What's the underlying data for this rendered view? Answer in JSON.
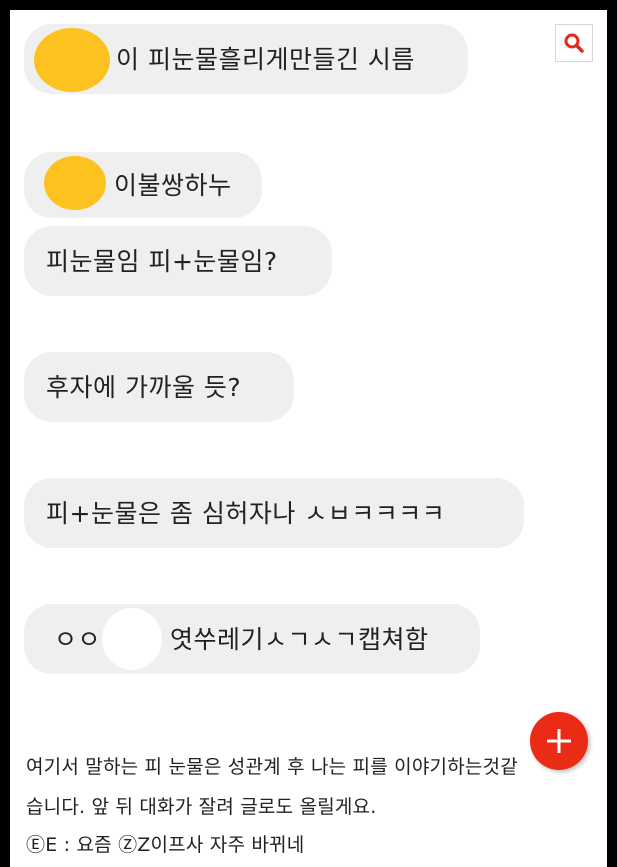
{
  "messages": [
    {
      "text": "이 피눈물흘리게만들긴 시름"
    },
    {
      "text": "이불쌍하누"
    },
    {
      "text": "피눈물임 피+눈물임?"
    },
    {
      "text": "후자에 가까울 듯?"
    },
    {
      "text": "피+눈물은 좀 심허자나 ㅅㅂㅋㅋㅋㅋ"
    },
    {
      "text_left": "ㅇㅇ",
      "text_right": "엿쑤레기ㅅㄱㅅㄱ캡쳐함"
    }
  ],
  "caption": {
    "line1": "여기서 말하는 피 눈물은 성관계 후 나는 피를 이야기하는것같",
    "line2": "습니다. 앞 뒤 대화가 잘려 글로도 올릴게요.",
    "line3": "ⒺE : 요즘 ⓏZ이프사 자주 바뀌네"
  },
  "icons": {
    "search": "search-icon",
    "add": "plus-icon"
  },
  "colors": {
    "bubble": "#efeff0",
    "accent": "#ea2b16",
    "censor": "#fcc21f"
  }
}
